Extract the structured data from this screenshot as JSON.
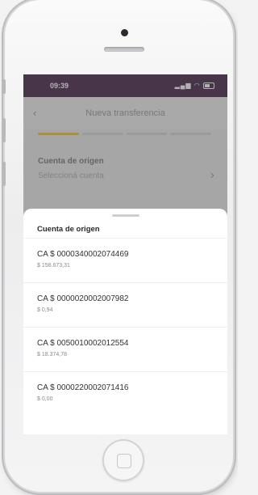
{
  "status_bar": {
    "time": "09:39",
    "signal_icon": "signal-icon",
    "wifi_icon": "wifi-icon",
    "battery_icon": "battery-icon"
  },
  "background_screen": {
    "title": "Nueva transferencia",
    "back_icon": "back-arrow-icon",
    "stepper": {
      "total_steps": 4,
      "active_step": 1
    },
    "origin_label": "Cuenta de origen",
    "origin_placeholder": "Seleccioná cuenta",
    "chevron_icon": "chevron-right-icon"
  },
  "sheet": {
    "title": "Cuenta de origen",
    "accounts": [
      {
        "name": "CA $ 0000340002074469",
        "balance": "$ 158.673,31"
      },
      {
        "name": "CA $ 0000020002007982",
        "balance": "$ 0,94"
      },
      {
        "name": "CA $ 0050010002012554",
        "balance": "$ 18.374,78"
      },
      {
        "name": "CA $ 0000220002071416",
        "balance": "$ 0,00"
      }
    ]
  },
  "colors": {
    "status_bar_bg": "#4a2a4d",
    "stepper_active": "#e8c35c"
  }
}
